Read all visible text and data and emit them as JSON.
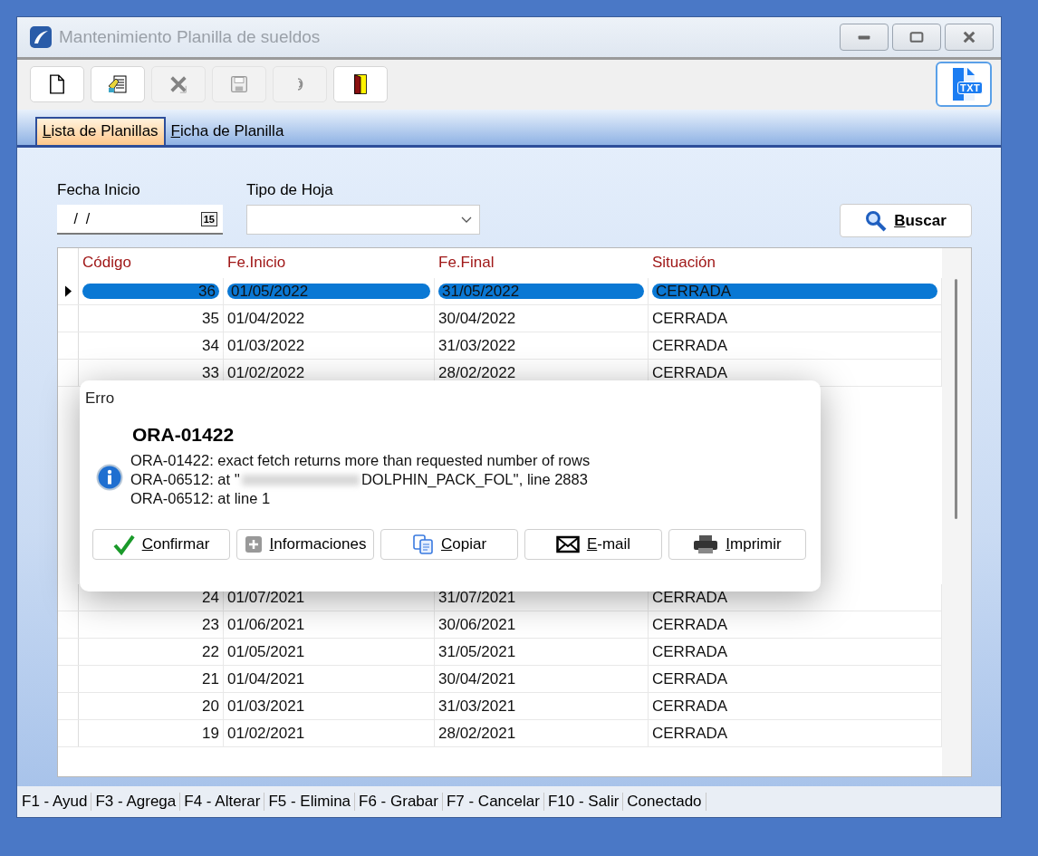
{
  "window": {
    "title": "Mantenimiento Planilla de sueldos"
  },
  "toolbar": [
    {
      "kind": "new",
      "disabled": false
    },
    {
      "kind": "edit",
      "disabled": false
    },
    {
      "kind": "delete",
      "disabled": true
    },
    {
      "kind": "save",
      "disabled": true
    },
    {
      "kind": "undo",
      "disabled": true
    },
    {
      "kind": "exit",
      "disabled": false
    }
  ],
  "export_button": {
    "label": "TXT"
  },
  "tabs": [
    {
      "label": "Lista de Planillas",
      "selected": true
    },
    {
      "label": "Ficha de Planilla",
      "selected": false
    }
  ],
  "filters": {
    "start_date": {
      "label": "Fecha Inicio",
      "value": " /  /",
      "calendar_label": "15"
    },
    "sheet_type": {
      "label": "Tipo de Hoja"
    },
    "search_button": "Buscar"
  },
  "table": {
    "columns": [
      "Código",
      "Fe.Inicio",
      "Fe.Final",
      "Situación"
    ],
    "rows_top": [
      {
        "cells": [
          "36",
          "01/05/2022",
          "31/05/2022",
          "CERRADA"
        ],
        "selected": true
      },
      {
        "cells": [
          "35",
          "01/04/2022",
          "30/04/2022",
          "CERRADA"
        ],
        "selected": false
      },
      {
        "cells": [
          "34",
          "01/03/2022",
          "31/03/2022",
          "CERRADA"
        ],
        "selected": false
      },
      {
        "cells": [
          "33",
          "01/02/2022",
          "28/02/2022",
          "CERRADA"
        ],
        "selected": false
      }
    ],
    "rows_bottom": [
      {
        "cells": [
          "24",
          "01/07/2021",
          "31/07/2021",
          "CERRADA"
        ],
        "selected": false
      },
      {
        "cells": [
          "23",
          "01/06/2021",
          "30/06/2021",
          "CERRADA"
        ],
        "selected": false
      },
      {
        "cells": [
          "22",
          "01/05/2021",
          "31/05/2021",
          "CERRADA"
        ],
        "selected": false
      },
      {
        "cells": [
          "21",
          "01/04/2021",
          "30/04/2021",
          "CERRADA"
        ],
        "selected": false
      },
      {
        "cells": [
          "20",
          "01/03/2021",
          "31/03/2021",
          "CERRADA"
        ],
        "selected": false
      },
      {
        "cells": [
          "19",
          "01/02/2021",
          "28/02/2021",
          "CERRADA"
        ],
        "selected": false
      }
    ]
  },
  "dialog": {
    "title": "Erro",
    "heading": "ORA-01422",
    "lines": [
      {
        "before": "ORA-01422: exact fetch returns more than requested number of rows",
        "redacted": false
      },
      {
        "before": "ORA-06512: at ''",
        "redacted": true,
        "after": "DOLPHIN_PACK_FOL'', line 2883"
      },
      {
        "before": "ORA-06512: at line 1",
        "redacted": false
      }
    ],
    "buttons": [
      {
        "kind": "confirm",
        "label": "Confirmar"
      },
      {
        "kind": "info",
        "label": "Informaciones"
      },
      {
        "kind": "copy",
        "label": "Copiar"
      },
      {
        "kind": "email",
        "label": "E-mail"
      },
      {
        "kind": "print",
        "label": "Imprimir"
      }
    ]
  },
  "status_bar": [
    "F1 - Ayud",
    "F3 - Agrega",
    "F4 - Alterar",
    "F5 - Elimina",
    "F6 - Grabar",
    "F7 - Cancelar",
    "F10 - Salir",
    "Conectado"
  ]
}
